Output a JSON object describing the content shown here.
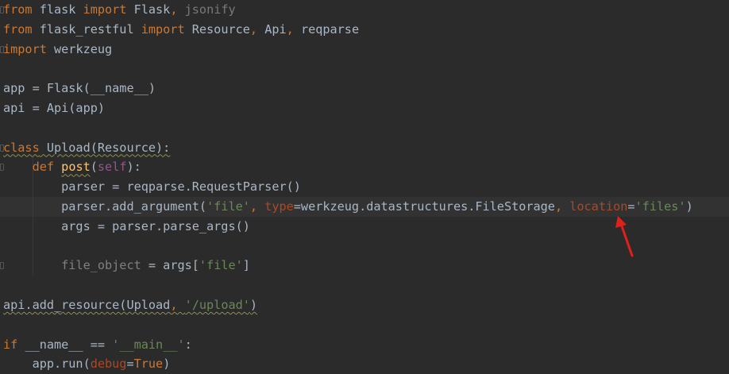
{
  "editor": {
    "lines": [
      {
        "parts": [
          {
            "t": "from",
            "c": "kw"
          },
          {
            "t": " flask ",
            "c": ""
          },
          {
            "t": "import",
            "c": "kw"
          },
          {
            "t": " Flask",
            "c": ""
          },
          {
            "t": ", ",
            "c": "punct"
          },
          {
            "t": "jsonify",
            "c": "dim"
          }
        ]
      },
      {
        "parts": [
          {
            "t": "from",
            "c": "kw"
          },
          {
            "t": " flask_restful ",
            "c": ""
          },
          {
            "t": "import",
            "c": "kw"
          },
          {
            "t": " Resource",
            "c": ""
          },
          {
            "t": ", ",
            "c": "punct"
          },
          {
            "t": "Api",
            "c": ""
          },
          {
            "t": ", ",
            "c": "punct"
          },
          {
            "t": "reqparse",
            "c": ""
          }
        ]
      },
      {
        "parts": [
          {
            "t": "import",
            "c": "kw"
          },
          {
            "t": " werkzeug",
            "c": ""
          }
        ]
      },
      {
        "parts": []
      },
      {
        "parts": [
          {
            "t": "app = Flask(__name__)",
            "c": ""
          }
        ]
      },
      {
        "parts": [
          {
            "t": "api = Api(app)",
            "c": ""
          }
        ]
      },
      {
        "parts": []
      },
      {
        "parts": [
          {
            "t": "class",
            "c": "kw squiggle"
          },
          {
            "t": " Upload(Resource):",
            "c": "squiggle"
          }
        ]
      },
      {
        "parts": [
          {
            "t": "    ",
            "c": ""
          },
          {
            "t": "def",
            "c": "kw"
          },
          {
            "t": " ",
            "c": ""
          },
          {
            "t": "post",
            "c": "fn squiggle"
          },
          {
            "t": "(",
            "c": ""
          },
          {
            "t": "self",
            "c": "self"
          },
          {
            "t": "):",
            "c": ""
          }
        ]
      },
      {
        "parts": [
          {
            "t": "        parser = reqparse.RequestParser()",
            "c": ""
          }
        ]
      },
      {
        "parts": [
          {
            "t": "        parser.add_argument(",
            "c": ""
          },
          {
            "t": "'file'",
            "c": "str"
          },
          {
            "t": ", ",
            "c": "punct"
          },
          {
            "t": "type",
            "c": "param"
          },
          {
            "t": "=werkzeug.datastructures.FileStorage",
            "c": ""
          },
          {
            "t": ", ",
            "c": "punct"
          },
          {
            "t": "location",
            "c": "param"
          },
          {
            "t": "=",
            "c": ""
          },
          {
            "t": "'files'",
            "c": "str"
          },
          {
            "t": ")",
            "c": ""
          }
        ]
      },
      {
        "parts": [
          {
            "t": "        args = parser.parse_args()",
            "c": ""
          }
        ]
      },
      {
        "parts": []
      },
      {
        "parts": [
          {
            "t": "        ",
            "c": ""
          },
          {
            "t": "file_object",
            "c": "muted"
          },
          {
            "t": " = args[",
            "c": ""
          },
          {
            "t": "'file'",
            "c": "str"
          },
          {
            "t": "]",
            "c": ""
          }
        ]
      },
      {
        "parts": []
      },
      {
        "parts": [
          {
            "t": "api.add_resource(Upload",
            "c": "squiggle"
          },
          {
            "t": ", ",
            "c": "punct squiggle"
          },
          {
            "t": "'/upload'",
            "c": "str squiggle"
          },
          {
            "t": ")",
            "c": "squiggle"
          }
        ]
      },
      {
        "parts": []
      },
      {
        "parts": [
          {
            "t": "if",
            "c": "kw"
          },
          {
            "t": " __name__ == ",
            "c": ""
          },
          {
            "t": "'__main__'",
            "c": "str"
          },
          {
            "t": ":",
            "c": ""
          }
        ]
      },
      {
        "parts": [
          {
            "t": "    app.run(",
            "c": ""
          },
          {
            "t": "debug",
            "c": "param"
          },
          {
            "t": "=",
            "c": ""
          },
          {
            "t": "True",
            "c": "kw"
          },
          {
            "t": ")",
            "c": ""
          }
        ]
      }
    ],
    "current_line_index": 10,
    "fold_marker_lines": [
      0,
      2,
      7,
      8,
      13
    ],
    "annotation": {
      "color": "#e0201a"
    }
  }
}
